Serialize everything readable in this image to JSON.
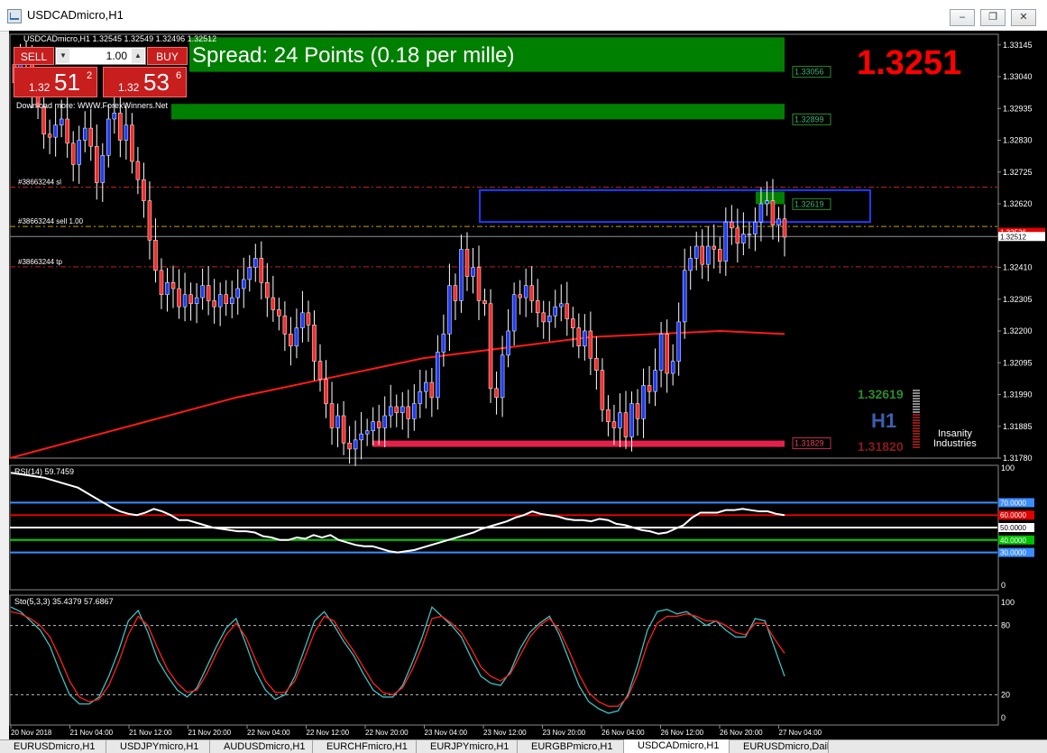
{
  "window": {
    "title": "USDCADmicro,H1",
    "buttons": [
      "–",
      "❐",
      "✕"
    ]
  },
  "trade_panel": {
    "sell_label": "SELL",
    "buy_label": "BUY",
    "lot": "1.00",
    "sell_price_prefix": "1.32",
    "sell_price_big": "51",
    "sell_price_sup": "2",
    "buy_price_prefix": "1.32",
    "buy_price_big": "53",
    "buy_price_sup": "6"
  },
  "overlay": {
    "spread_text": "Spread: 24 Points (0.18 per mille)",
    "big_price": "1.3251",
    "download_text": "Download more: WWW.ForexWinners.Net",
    "hi_value": "1.32619",
    "lo_value": "1.31820",
    "timeframe_badge": "H1",
    "brand_line1": "Insanity",
    "brand_line2": "Industries"
  },
  "tabs": [
    {
      "label": "EURUSDmicro,H1",
      "active": false
    },
    {
      "label": "USDJPYmicro,H1",
      "active": false
    },
    {
      "label": "AUDUSDmicro,H1",
      "active": false
    },
    {
      "label": "EURCHFmicro,H1",
      "active": false
    },
    {
      "label": "EURJPYmicro,H1",
      "active": false
    },
    {
      "label": "EURGBPmicro,H1",
      "active": false
    },
    {
      "label": "USDCADmicro,H1",
      "active": true
    },
    {
      "label": "EURUSDmicro,Daily",
      "active": false
    }
  ],
  "colors": {
    "bull": "#1e3cff",
    "bear": "#ff2a2a",
    "ma": "#ff1a1a",
    "zone_green": "#008000",
    "support_bar": "#e3214a",
    "rsi_line": "#ffffff",
    "sto_main": "#3fbfbf",
    "sto_signal": "#ff2020"
  },
  "chart_data": [
    {
      "type": "candlestick",
      "title": "USDCADmicro,H1 1.32545 1.32549 1.32496 1.32512",
      "ylim": [
        1.3178,
        1.3318
      ],
      "y_ticks": [
        "1.33145",
        "1.33040",
        "1.32935",
        "1.32830",
        "1.32725",
        "1.32620",
        "1.32515",
        "1.32410",
        "1.32305",
        "1.32200",
        "1.32095",
        "1.31990",
        "1.31885",
        "1.31780"
      ],
      "x_tick_labels": [
        "20 Nov 2018",
        "21 Nov 04:00",
        "21 Nov 12:00",
        "21 Nov 20:00",
        "22 Nov 04:00",
        "22 Nov 12:00",
        "22 Nov 20:00",
        "23 Nov 04:00",
        "23 Nov 12:00",
        "23 Nov 20:00",
        "26 Nov 04:00",
        "26 Nov 12:00",
        "26 Nov 20:00",
        "27 Nov 04:00"
      ],
      "candles_close": [
        1.3302,
        1.331,
        1.3308,
        1.33,
        1.3294,
        1.3285,
        1.3284,
        1.3288,
        1.329,
        1.3282,
        1.3275,
        1.3283,
        1.3287,
        1.3281,
        1.3269,
        1.3278,
        1.329,
        1.3292,
        1.3283,
        1.3288,
        1.3276,
        1.327,
        1.3263,
        1.325,
        1.324,
        1.3232,
        1.3236,
        1.3234,
        1.3228,
        1.3232,
        1.3229,
        1.3231,
        1.3235,
        1.323,
        1.3228,
        1.3232,
        1.3229,
        1.3231,
        1.3234,
        1.3237,
        1.3241,
        1.3244,
        1.3236,
        1.3231,
        1.3227,
        1.3225,
        1.3219,
        1.3215,
        1.3221,
        1.3226,
        1.3222,
        1.321,
        1.3204,
        1.3196,
        1.3188,
        1.3192,
        1.3183,
        1.3181,
        1.3184,
        1.3186,
        1.3187,
        1.319,
        1.3188,
        1.3192,
        1.3195,
        1.3193,
        1.3195,
        1.3191,
        1.3196,
        1.32,
        1.3203,
        1.3198,
        1.3213,
        1.3219,
        1.3235,
        1.323,
        1.3247,
        1.3238,
        1.3241,
        1.323,
        1.3229,
        1.3201,
        1.3198,
        1.3212,
        1.322,
        1.3232,
        1.3231,
        1.3235,
        1.323,
        1.3226,
        1.3223,
        1.3225,
        1.3228,
        1.3229,
        1.3224,
        1.3221,
        1.3215,
        1.322,
        1.3211,
        1.3207,
        1.3194,
        1.319,
        1.3188,
        1.3193,
        1.3185,
        1.3196,
        1.3191,
        1.3202,
        1.32,
        1.3207,
        1.3219,
        1.3206,
        1.321,
        1.3223,
        1.324,
        1.3244,
        1.3248,
        1.3242,
        1.3248,
        1.3247,
        1.3243,
        1.3256,
        1.3254,
        1.3249,
        1.3252,
        1.3252,
        1.3256,
        1.3262,
        1.3263,
        1.3255,
        1.3257,
        1.3251
      ],
      "ma_line": [
        [
          1.3178,
          0
        ],
        [
          1.3198,
          70
        ],
        [
          1.3211,
          128
        ],
        [
          1.3218,
          180
        ],
        [
          1.322,
          220
        ],
        [
          1.3219,
          240
        ]
      ],
      "hlines": [
        {
          "label": "#38663244 sl",
          "value": 1.32675
        },
        {
          "label": "#38663244 sell 1.00",
          "value": 1.32545
        },
        {
          "label": "#38663244 tp",
          "value": 1.32412
        }
      ],
      "zones": [
        {
          "label": "1.33056",
          "top": 1.3317,
          "bottom": 1.33056
        },
        {
          "label": "1.32899",
          "top": 1.3295,
          "bottom": 1.32899
        },
        {
          "label": "1.32619",
          "top": 1.3266,
          "bottom": 1.32619
        },
        {
          "label": "1.31829",
          "top": 1.3184,
          "bottom": 1.31829
        }
      ],
      "current_price_labels": [
        "1.32526",
        "1.32512"
      ]
    },
    {
      "type": "line",
      "title": "RSI(14) 59.7459",
      "ylim": [
        0,
        100
      ],
      "levels": [
        "70.0000",
        "60.0000",
        "50.0000",
        "40.0000",
        "30.0000"
      ],
      "y_ticks": [
        "100",
        "0"
      ],
      "values": [
        94,
        93,
        92,
        91,
        90,
        88,
        86,
        84,
        82,
        78,
        74,
        70,
        66,
        63,
        61,
        60,
        62,
        65,
        63,
        60,
        56,
        56,
        54,
        52,
        50,
        49,
        48,
        47,
        47,
        46,
        43,
        42,
        40,
        40,
        42,
        41,
        44,
        42,
        44,
        40,
        38,
        36,
        35,
        35,
        33,
        31,
        30,
        31,
        32,
        34,
        36,
        38,
        40,
        42,
        44,
        46,
        49,
        51,
        53,
        55,
        58,
        60,
        63,
        61,
        60,
        59,
        57,
        56,
        56,
        55,
        57,
        56,
        53,
        52,
        50,
        48,
        47,
        45,
        46,
        49,
        52,
        58,
        62,
        62,
        62,
        64,
        64,
        65,
        64,
        63,
        63,
        61,
        60
      ],
      "series": [
        {
          "name": "RSI(14)",
          "last": 59.7459
        }
      ]
    },
    {
      "type": "line",
      "title": "Sto(5,3,3) 35.4379 57.6867",
      "ylim": [
        0,
        100
      ],
      "levels": [
        "80",
        "20"
      ],
      "y_ticks": [
        "100",
        "80",
        "20",
        "0"
      ],
      "series": [
        {
          "name": "Sto(5,3,3)",
          "last": 35.4379,
          "values": [
            96,
            92,
            84,
            76,
            62,
            40,
            20,
            12,
            12,
            18,
            36,
            58,
            84,
            93,
            74,
            50,
            36,
            24,
            18,
            26,
            44,
            62,
            78,
            86,
            64,
            40,
            24,
            16,
            20,
            36,
            60,
            84,
            92,
            80,
            66,
            54,
            38,
            24,
            18,
            18,
            28,
            48,
            70,
            96,
            88,
            80,
            70,
            52,
            36,
            30,
            28,
            40,
            60,
            74,
            82,
            88,
            72,
            50,
            28,
            14,
            8,
            4,
            6,
            20,
            46,
            76,
            92,
            94,
            90,
            92,
            86,
            80,
            84,
            76,
            70,
            70,
            86,
            84,
            60,
            36
          ]
        },
        {
          "name": "signal",
          "last": 57.6867,
          "values": [
            92,
            90,
            86,
            80,
            70,
            52,
            32,
            18,
            14,
            16,
            28,
            48,
            72,
            88,
            80,
            60,
            42,
            30,
            22,
            24,
            38,
            56,
            72,
            82,
            70,
            50,
            32,
            22,
            22,
            32,
            52,
            74,
            88,
            84,
            70,
            58,
            44,
            30,
            22,
            20,
            26,
            42,
            62,
            86,
            88,
            82,
            74,
            60,
            44,
            36,
            32,
            38,
            54,
            70,
            80,
            86,
            76,
            58,
            38,
            22,
            14,
            10,
            10,
            18,
            38,
            64,
            82,
            88,
            88,
            90,
            88,
            84,
            84,
            80,
            74,
            72,
            82,
            82,
            68,
            56
          ]
        }
      ]
    }
  ]
}
